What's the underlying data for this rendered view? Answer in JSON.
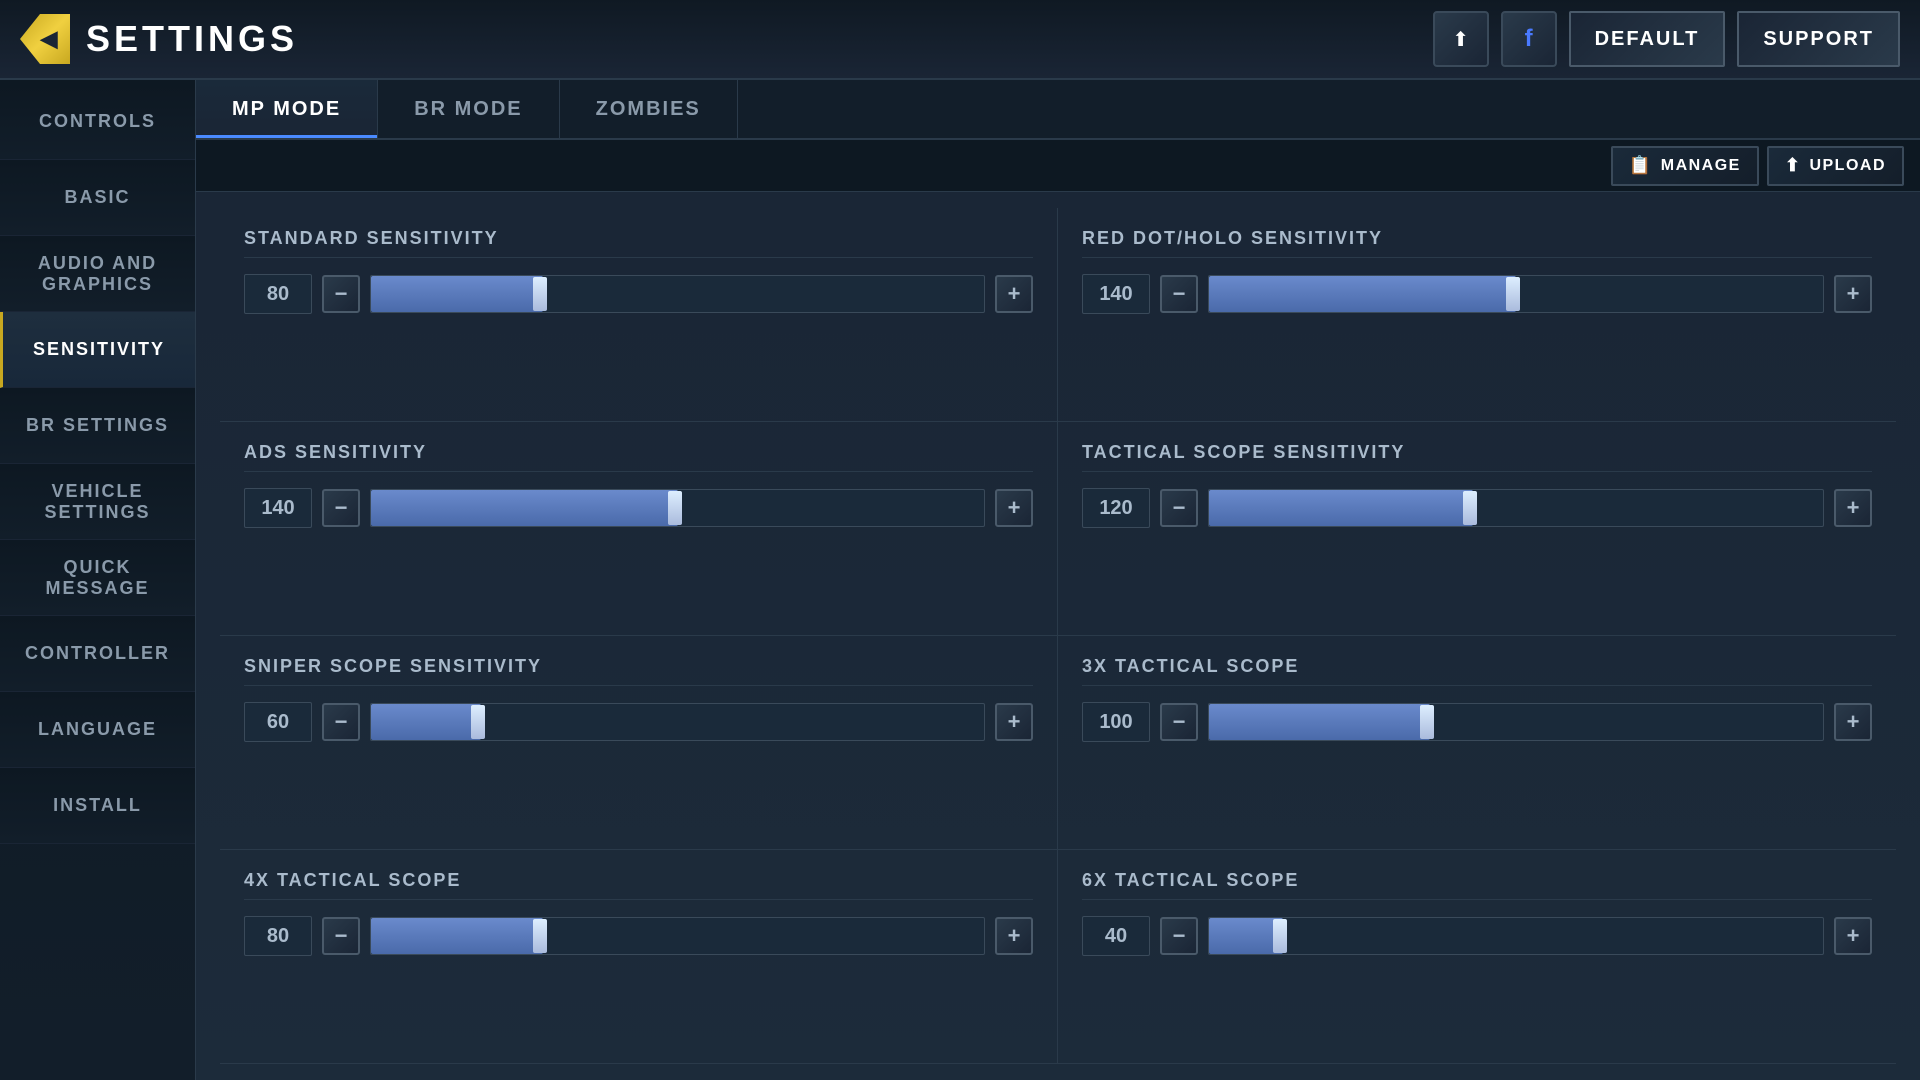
{
  "header": {
    "back_label": "◀",
    "title": "SETTINGS",
    "icons": [
      "rank-icon",
      "facebook-icon"
    ],
    "default_btn": "DEFAULT",
    "support_btn": "SUPPORT"
  },
  "sidebar": {
    "items": [
      {
        "id": "controls",
        "label": "CONTROLS",
        "active": false
      },
      {
        "id": "basic",
        "label": "BASIC",
        "active": false
      },
      {
        "id": "audio-graphics",
        "label": "AUDIO AND GRAPHICS",
        "active": false
      },
      {
        "id": "sensitivity",
        "label": "SENSITIVITY",
        "active": true
      },
      {
        "id": "br-settings",
        "label": "BR SETTINGS",
        "active": false
      },
      {
        "id": "vehicle-settings",
        "label": "VEHICLE SETTINGS",
        "active": false
      },
      {
        "id": "quick-message",
        "label": "QUICK MESSAGE",
        "active": false
      },
      {
        "id": "controller",
        "label": "CONTROLLER",
        "active": false
      },
      {
        "id": "language",
        "label": "LANGUAGE",
        "active": false
      },
      {
        "id": "install",
        "label": "INSTALL",
        "active": false
      }
    ]
  },
  "tabs": [
    {
      "id": "mp-mode",
      "label": "MP MODE",
      "active": true
    },
    {
      "id": "br-mode",
      "label": "BR MODE",
      "active": false
    },
    {
      "id": "zombies",
      "label": "ZOMBIES",
      "active": false
    }
  ],
  "toolbar": {
    "manage_label": "MANAGE",
    "upload_label": "UPLOAD"
  },
  "sensitivity_settings": [
    {
      "id": "standard",
      "label": "STANDARD SENSITIVITY",
      "value": 80,
      "fill_pct": 28
    },
    {
      "id": "red-dot-holo",
      "label": "RED DOT/HOLO SENSITIVITY",
      "value": 140,
      "fill_pct": 50
    },
    {
      "id": "ads",
      "label": "ADS SENSITIVITY",
      "value": 140,
      "fill_pct": 50
    },
    {
      "id": "tactical-scope",
      "label": "TACTICAL SCOPE SENSITIVITY",
      "value": 120,
      "fill_pct": 43
    },
    {
      "id": "sniper-scope",
      "label": "SNIPER SCOPE SENSITIVITY",
      "value": 60,
      "fill_pct": 18
    },
    {
      "id": "3x-tactical",
      "label": "3x TACTICAL SCOPE",
      "value": 100,
      "fill_pct": 36
    },
    {
      "id": "4x-tactical",
      "label": "4x TACTICAL SCOPE",
      "value": 80,
      "fill_pct": 28
    },
    {
      "id": "6x-tactical",
      "label": "6X TACTICAL SCOPE",
      "value": 40,
      "fill_pct": 12
    }
  ]
}
